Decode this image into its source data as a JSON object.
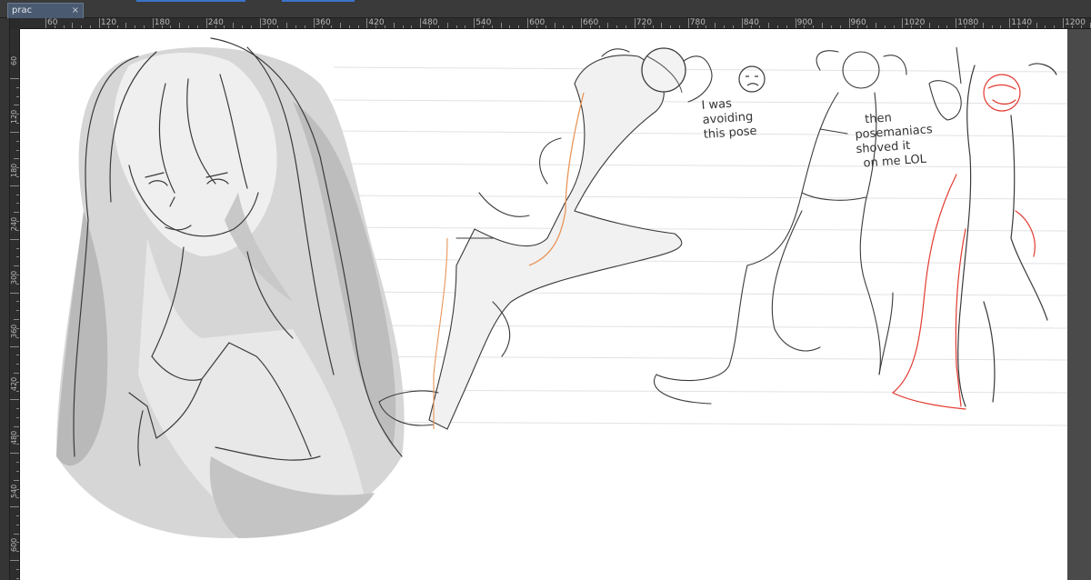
{
  "document": {
    "tab_label": "prac",
    "tab_close": "×"
  },
  "ruler": {
    "h_labels": [
      "60",
      "120",
      "180",
      "240",
      "300",
      "360",
      "420",
      "480",
      "540",
      "600",
      "660",
      "720",
      "780",
      "840",
      "900",
      "960",
      "1020",
      "1080",
      "1140",
      "1200"
    ],
    "v_labels": [
      "60",
      "120",
      "180",
      "240",
      "300",
      "360",
      "420",
      "480",
      "540",
      "600"
    ]
  },
  "annotations": {
    "qqq": "???",
    "note1": "I was\navoiding\nthis pose",
    "note2": "then\nposemaniacs\nshoved it\non me LOL"
  },
  "colors": {
    "canvas": "#ffffff",
    "workspace": "#2b2b2b",
    "sketch": "#3a3a3a",
    "orange_guide": "#e8955a",
    "red_guide": "#e23a30",
    "tab_accent": "#3b73c8"
  }
}
